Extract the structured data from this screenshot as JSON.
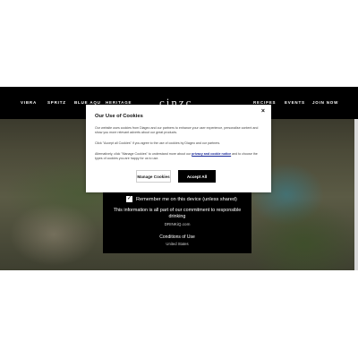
{
  "nav": {
    "left_items": [
      "VIBRA",
      "SPRITZ",
      "BLUE AQU",
      "HERITAGE"
    ],
    "brand": "cinzc",
    "right_items": [
      "RECIPES",
      "EVENTS",
      "JOIN NOW"
    ]
  },
  "age_gate": {
    "remember_checked": true,
    "remember_label": "Remember me on this device (unless shared)",
    "info_text": "This information is all part of our commitment to responsible drinking",
    "domain": "DRINKiQ.com",
    "terms_label": "Conditions of Use",
    "country": "United States"
  },
  "cookie_banner": {
    "title": "Our Use of Cookies",
    "close_glyph": "×",
    "paragraph1": "Our website uses cookies from Diageo and our partners to enhance your user experience, personalise content and show you more relevant adverts about our great products.",
    "paragraph2": "Click \"Accept all Cookies\" if you agree to the use of cookies by Diageo and our partners.",
    "paragraph3_before": "Alternatively, click \"Manage Cookies\" to understand more about our",
    "policy_link": "privacy and cookie notice",
    "paragraph3_after": "and to choose the types of cookies you are happy for us to use.",
    "manage_label": "Manage Cookies",
    "accept_label": "Accept All"
  },
  "colors": {
    "nav_bg": "#000000",
    "link": "#1a2a9a",
    "accept_bg": "#000000"
  }
}
